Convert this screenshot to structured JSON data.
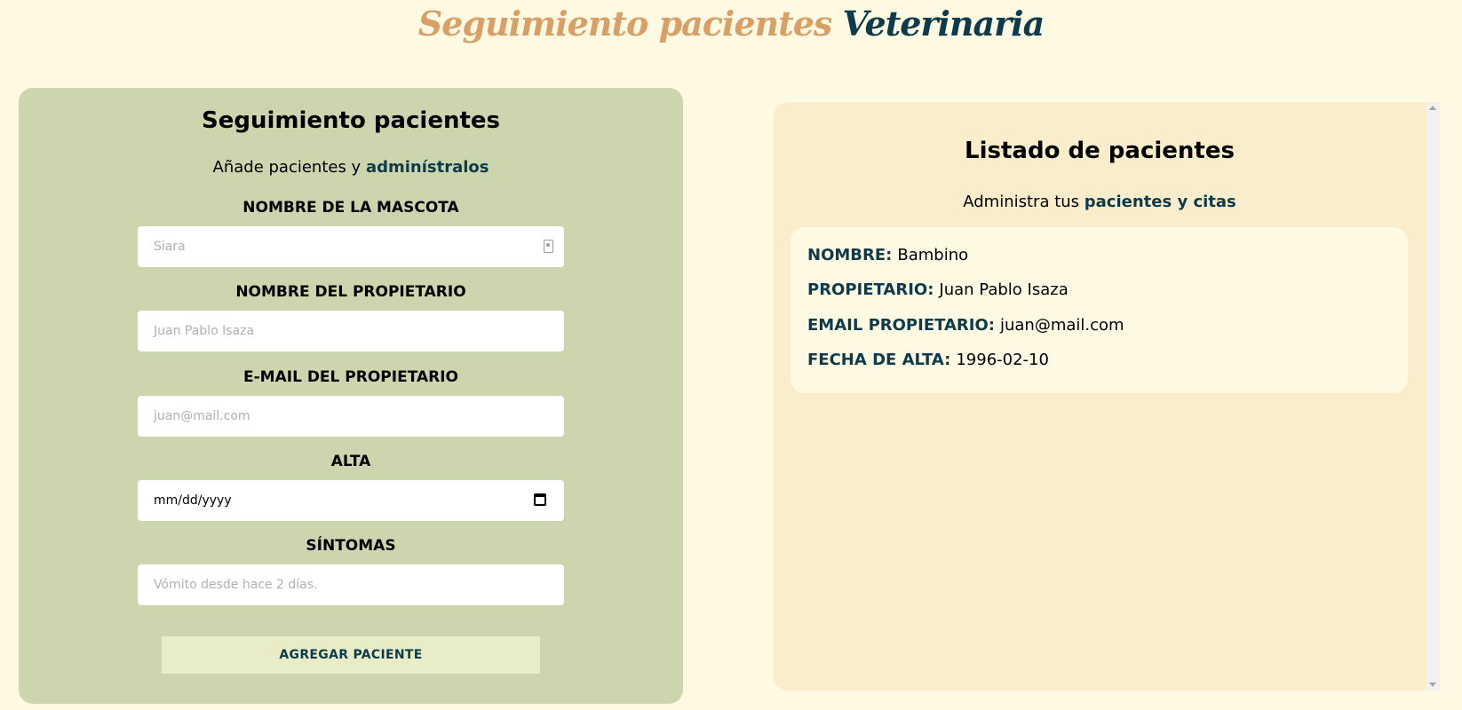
{
  "header": {
    "title_part1": "Seguimiento pacientes",
    "title_part2": "Veterinaria"
  },
  "form": {
    "title": "Seguimiento pacientes",
    "subtitle_prefix": "Añade pacientes y ",
    "subtitle_emphasis": "adminístralos",
    "fields": [
      {
        "label": "NOMBRE DE LA MASCOTA",
        "placeholder": "Siara"
      },
      {
        "label": "NOMBRE DEL PROPIETARIO",
        "placeholder": "Juan Pablo Isaza"
      },
      {
        "label": "E-MAIL DEL PROPIETARIO",
        "placeholder": "juan@mail.com"
      },
      {
        "label": "ALTA",
        "placeholder": "mm/dd/yyyy"
      },
      {
        "label": "SÍNTOMAS",
        "placeholder": "Vómito desde hace 2 días."
      }
    ],
    "submit_label": "AGREGAR PACIENTE"
  },
  "list": {
    "title": "Listado de pacientes",
    "subtitle_prefix": "Administra tus ",
    "subtitle_emphasis": "pacientes y citas",
    "patients": [
      {
        "nombre_label": "NOMBRE:",
        "nombre": "Bambino",
        "propietario_label": "PROPIETARIO:",
        "propietario": "Juan Pablo Isaza",
        "email_label": "EMAIL PROPIETARIO:",
        "email": "juan@mail.com",
        "fecha_label": "FECHA DE ALTA:",
        "fecha": "1996-02-10"
      }
    ]
  },
  "colors": {
    "background": "#fef9e2",
    "form_panel": "#cdd5ae",
    "list_panel": "#faedcb",
    "accent_dark": "#0d3b4c",
    "accent_tan": "#d9a066",
    "button_bg": "#e8ecc7"
  },
  "icons": [
    "contact-card-icon",
    "calendar-icon",
    "scroll-up-arrow-icon",
    "scroll-down-arrow-icon"
  ]
}
